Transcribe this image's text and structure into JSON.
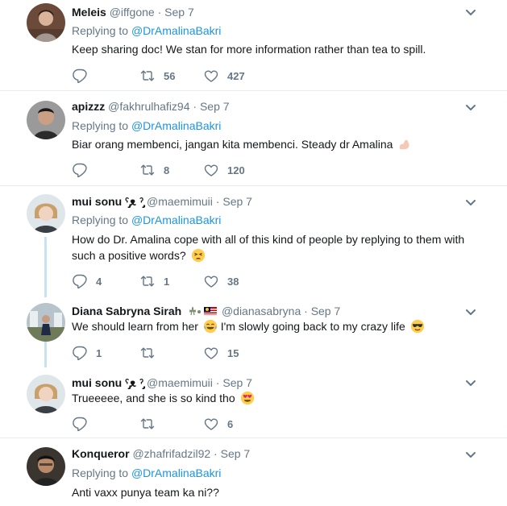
{
  "tweets": [
    {
      "name": "Meleis",
      "handle": "@iffgone",
      "date": "Sep 7",
      "replying_label": "Replying to",
      "replying_to": "@DrAmalinaBakri",
      "text": "Keep sharing doc! We stan for more information rather than tea to spill.",
      "replies": "",
      "retweets": "56",
      "likes": "427"
    },
    {
      "name": "apizzz",
      "handle": "@fakhrulhafiz94",
      "date": "Sep 7",
      "replying_label": "Replying to",
      "replying_to": "@DrAmalinaBakri",
      "text": "Biar orang membenci, jangan kita membenci. Steady dr Amalina",
      "emoji": "flexed-biceps",
      "replies": "",
      "retweets": "8",
      "likes": "120"
    },
    {
      "name": "mui sonu ˁ̡̡ᴥ ˀ̡̡",
      "handle": "@maemimuii",
      "date": "Sep 7",
      "replying_label": "Replying to",
      "replying_to": "@DrAmalinaBakri",
      "text": "How do Dr. Amalina cope with all of this kind of people by replying to them with such a positive words?",
      "emoji": "tired-face",
      "replies": "4",
      "retweets": "1",
      "likes": "38"
    },
    {
      "name": "Diana Sabryna Sirah",
      "handle": "@dianasabryna",
      "date": "Sep 7",
      "text": "We should learn from her",
      "emoji": "tears-of-joy",
      "text2": "I'm slowly going back to my crazy life",
      "emoji2": "sunglasses-face",
      "replies": "1",
      "retweets": "",
      "likes": "15"
    },
    {
      "name": "mui sonu ˁ̡̡ᴥ ˀ̡̡",
      "handle": "@maemimuii",
      "date": "Sep 7",
      "text": "Trueeeee, and she is so kind tho",
      "emoji": "heart-eyes-face",
      "replies": "",
      "retweets": "",
      "likes": "6"
    },
    {
      "name": "Konqueror",
      "handle": "@zhafrifadzil92",
      "date": "Sep 7",
      "replying_label": "Replying to",
      "replying_to": "@DrAmalinaBakri",
      "text": "Anti vaxx punya team ka ni??"
    }
  ],
  "separator": "·",
  "icons": {
    "reply": "reply-icon",
    "retweet": "retweet-icon",
    "like": "heart-icon",
    "menu": "chevron-down-icon"
  },
  "colors": {
    "mention": "#1b95e0",
    "muted": "#657786",
    "thread": "#c4e3f5",
    "divider": "#e6ecf0"
  }
}
